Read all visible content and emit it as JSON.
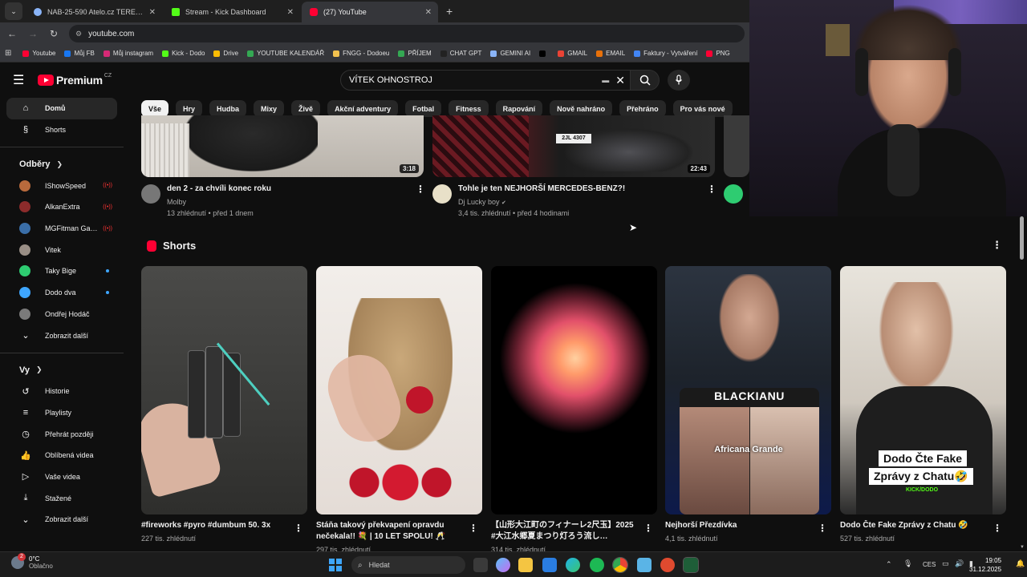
{
  "tabs": [
    {
      "title": "NAB-25-590 Atelo.cz TEREZA S",
      "color": "#8ab4f8"
    },
    {
      "title": "Stream - Kick Dashboard",
      "color": "#53fc18"
    },
    {
      "title": "(27) YouTube",
      "color": "#ff0033"
    }
  ],
  "address": "youtube.com",
  "bookmarks": [
    {
      "label": "Youtube",
      "color": "#ff0033"
    },
    {
      "label": "Můj FB",
      "color": "#1877f2"
    },
    {
      "label": "Můj instagram",
      "color": "#d62976"
    },
    {
      "label": "Kick - Dodo",
      "color": "#53fc18"
    },
    {
      "label": "Drive",
      "color": "#fbbc04"
    },
    {
      "label": "YOUTUBE KALENDÁŘ",
      "color": "#34a853"
    },
    {
      "label": "FNGG - Dodoeu",
      "color": "#f2c14e"
    },
    {
      "label": "PŘÍJEM",
      "color": "#34a853"
    },
    {
      "label": "CHAT GPT",
      "color": "#222222"
    },
    {
      "label": "GEMINI AI",
      "color": "#8ab4f8"
    },
    {
      "label": "",
      "color": "#000000"
    },
    {
      "label": "GMAIL",
      "color": "#ea4335"
    },
    {
      "label": "EMAIL",
      "color": "#e8710a"
    },
    {
      "label": "Faktury - Vytváření",
      "color": "#4285f4"
    },
    {
      "label": "PNG",
      "color": "#ff0033"
    }
  ],
  "yt": {
    "logo": "Premium",
    "logo_region": "CZ",
    "search_query": "VÍTEK OHNOSTROJ",
    "chips": [
      "Vše",
      "Hry",
      "Hudba",
      "Mixy",
      "Živě",
      "Akční adventury",
      "Fotbal",
      "Fitness",
      "Rapování",
      "Nově nahráno",
      "Přehráno",
      "Pro vás nové"
    ],
    "sidebar": {
      "main": [
        {
          "label": "Domů",
          "icon": "home-icon"
        },
        {
          "label": "Shorts",
          "icon": "shorts-icon"
        }
      ],
      "subs_title": "Odběry",
      "subs": [
        {
          "label": "IShowSpeed",
          "status": "live",
          "color": "#b86a3c"
        },
        {
          "label": "AlkanExtra",
          "status": "live",
          "color": "#8c2b2b"
        },
        {
          "label": "MGFitman Gaming",
          "status": "live",
          "color": "#3a6ea8"
        },
        {
          "label": "Vitek",
          "status": "",
          "color": "#9a8f86"
        },
        {
          "label": "Taky Bige",
          "status": "new",
          "color": "#2ecc71"
        },
        {
          "label": "Dodo dva",
          "status": "new",
          "color": "#3ea6ff"
        },
        {
          "label": "Ondřej Hodáč",
          "status": "",
          "color": "#7a7a7a"
        }
      ],
      "subs_more": "Zobrazit další",
      "you_title": "Vy",
      "you": [
        {
          "label": "Historie",
          "icon": "history-icon"
        },
        {
          "label": "Playlisty",
          "icon": "playlists-icon"
        },
        {
          "label": "Přehrát později",
          "icon": "watch-later-icon"
        },
        {
          "label": "Oblíbená videa",
          "icon": "liked-icon"
        },
        {
          "label": "Vaše videa",
          "icon": "your-videos-icon"
        },
        {
          "label": "Stažené",
          "icon": "downloads-icon"
        },
        {
          "label": "Zobrazit další",
          "icon": "chevron-down-icon"
        }
      ]
    },
    "videos": [
      {
        "title": "den 2 - za chvíli konec roku",
        "channel": "Molby",
        "stats": "13 zhlédnutí • před 1 dnem",
        "duration": "3:18",
        "verified": false
      },
      {
        "title": "Tohle je ten NEJHORŠÍ MERCEDES-BENZ?!",
        "channel": "Dj Lucky boy",
        "stats": "3,4 tis. zhlédnutí • před 4 hodinami",
        "duration": "22:43",
        "verified": true
      }
    ],
    "car_plate": "2JL 4307",
    "shorts_title": "Shorts",
    "shorts": [
      {
        "title": "#fireworks #pyro  #dumbum 50.   3x",
        "views": "227 tis. zhlédnutí"
      },
      {
        "title": "Stáňa takový překvapení opravdu nečekala!! 💐 | 10 LET SPOLU! 🥂",
        "views": "297 tis. zhlédnutí"
      },
      {
        "title": "【山形大江町のフィナーレ2尺玉】2025 #大江水郷夏まつり灯ろう流し…",
        "views": "314 tis. zhlédnutí"
      },
      {
        "title": "Nejhorší Přezdívka",
        "views": "4,1 tis. zhlédnutí"
      },
      {
        "title": "Dodo Čte Fake Zprávy z Chatu 🤣",
        "views": "527 tis. zhlédnutí"
      }
    ],
    "short_overlays": {
      "blackianu": "BLACKIANU",
      "africana": "Africana Grande",
      "dodo_caption_1": "Dodo Čte Fake",
      "dodo_caption_2": "Zprávy z Chatu🤣",
      "kick_tag": "KICK/DODO"
    }
  },
  "taskbar": {
    "temp": "0°C",
    "weather": "Oblačno",
    "badge": "2",
    "search_placeholder": "Hledat",
    "lang": "CES",
    "time": "19:05",
    "date": "31.12.2025"
  }
}
